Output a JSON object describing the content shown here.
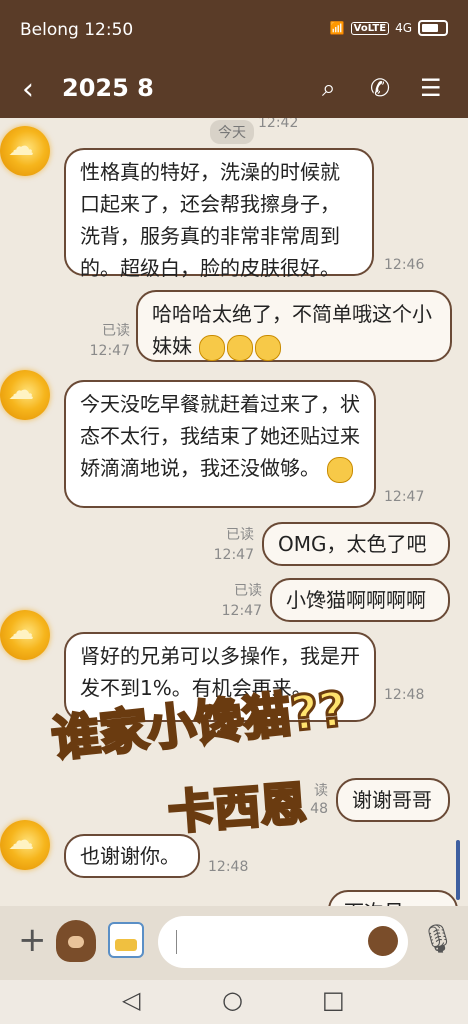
{
  "status": {
    "carrier_time": "Belong 12:50",
    "volte": "VoLTE",
    "signal": "4G"
  },
  "header": {
    "back": "‹",
    "title": "2025 8",
    "search_icon": "⌕",
    "call_icon": "✆",
    "menu_icon": "☰"
  },
  "chat": {
    "day_label": "今天",
    "top_time": "12:42",
    "messages": [
      {
        "from": "them",
        "text": "性格真的特好，洗澡的时候就口起来了，还会帮我擦身子，洗背，服务真的非常非常周到的。超级白，脸的皮肤很好。",
        "time": "12:46"
      },
      {
        "from": "me",
        "text": "哈哈哈太绝了，不简单哦这个小妹妹",
        "read": "已读",
        "time": "12:47"
      },
      {
        "from": "them",
        "text": "今天没吃早餐就赶着过来了，状态不太行，我结束了她还贴过来娇滴滴地说，我还没做够。",
        "time": "12:47"
      },
      {
        "from": "me",
        "text": "OMG，太色了吧",
        "read": "已读",
        "time": "12:47"
      },
      {
        "from": "me",
        "text": "小馋猫啊啊啊啊",
        "read": "已读",
        "time": "12:47"
      },
      {
        "from": "them",
        "text": "肾好的兄弟可以多操作，我是开发不到1%。有机会再来。",
        "time": "12:48"
      },
      {
        "from": "me",
        "text": "谢谢哥哥",
        "read": "读",
        "time": "48"
      },
      {
        "from": "them",
        "text": "也谢谢你。",
        "time": "12:48"
      }
    ],
    "partial_bottom": "下次见"
  },
  "overlay": {
    "line1": "谁家小馋猫??",
    "line2": "卡西恩"
  },
  "input": {
    "plus_icon": "+",
    "mic_icon": "🎙"
  },
  "nav": {
    "back": "◁",
    "home": "○",
    "recents": "□"
  }
}
